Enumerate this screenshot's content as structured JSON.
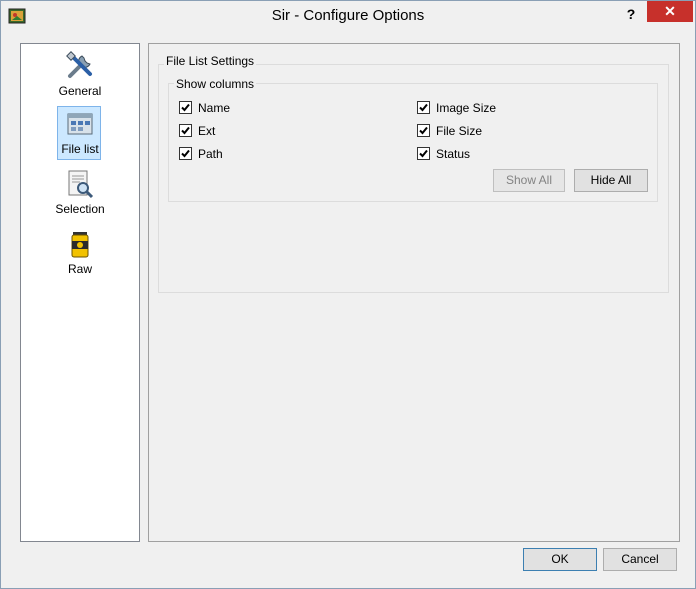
{
  "window": {
    "title": "Sir - Configure Options",
    "help": "?",
    "close": "✕"
  },
  "sidebar": {
    "items": [
      {
        "label": "General",
        "icon": "tools-icon"
      },
      {
        "label": "File list",
        "icon": "file-list-icon",
        "selected": true
      },
      {
        "label": "Selection",
        "icon": "selection-icon"
      },
      {
        "label": "Raw",
        "icon": "raw-icon"
      }
    ]
  },
  "file_list_settings": {
    "title": "File List Settings",
    "show_columns": {
      "title": "Show columns",
      "columns": [
        {
          "label": "Name",
          "checked": true
        },
        {
          "label": "Ext",
          "checked": true
        },
        {
          "label": "Path",
          "checked": true
        },
        {
          "label": "Image Size",
          "checked": true
        },
        {
          "label": "File Size",
          "checked": true
        },
        {
          "label": "Status",
          "checked": true
        }
      ],
      "show_all": "Show All",
      "hide_all": "Hide All"
    }
  },
  "footer": {
    "ok": "OK",
    "cancel": "Cancel"
  },
  "colors": {
    "close_button": "#c7302b",
    "selection_bg": "#cce8ff",
    "selection_border": "#7eb4ea"
  }
}
